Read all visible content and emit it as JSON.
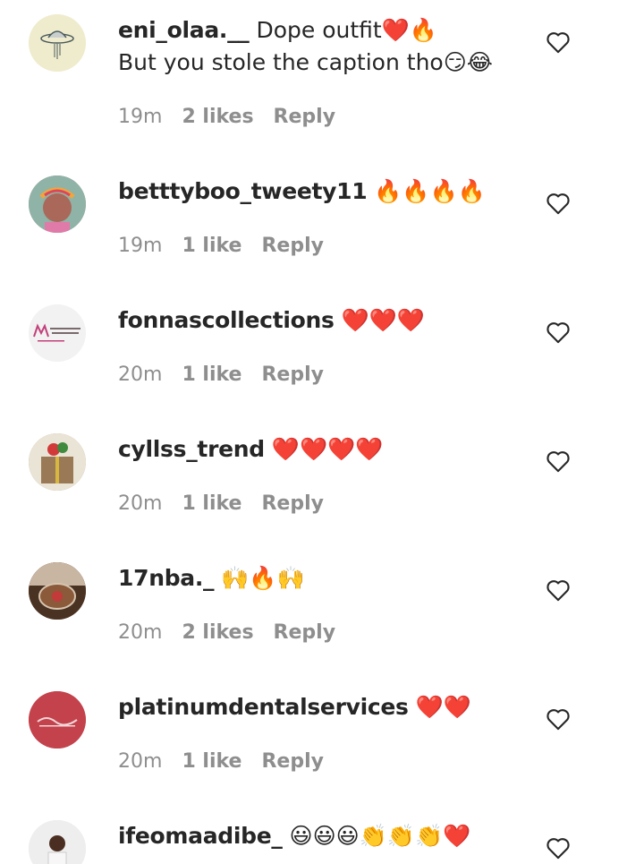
{
  "comments": [
    {
      "username": "eni_olaa.__",
      "text": "Dope outfit❤️🔥",
      "text2": "But you stole the caption tho😏😂",
      "time": "19m",
      "likes": "2 likes",
      "reply": "Reply",
      "avatar_icon": "ufo-icon",
      "avatar_color": "#efeccd"
    },
    {
      "username": "betttyboo_tweety11",
      "text": "🔥🔥🔥🔥",
      "time": "19m",
      "likes": "1 like",
      "reply": "Reply",
      "avatar_icon": "child-photo",
      "avatar_color": "#c48a8a"
    },
    {
      "username": "fonnascollections",
      "text": "❤️❤️❤️",
      "time": "20m",
      "likes": "1 like",
      "reply": "Reply",
      "avatar_icon": "fonnas-logo",
      "avatar_color": "#f2f2f2"
    },
    {
      "username": "cyllss_trend",
      "text": "❤️❤️❤️❤️",
      "time": "20m",
      "likes": "1 like",
      "reply": "Reply",
      "avatar_icon": "gift-box-photo",
      "avatar_color": "#b39a78"
    },
    {
      "username": "17nba._",
      "text": "🙌🔥🙌",
      "time": "20m",
      "likes": "2 likes",
      "reply": "Reply",
      "avatar_icon": "tea-cup-photo",
      "avatar_color": "#6b4a33"
    },
    {
      "username": "platinumdentalservices",
      "text": "❤️❤️",
      "time": "20m",
      "likes": "1 like",
      "reply": "Reply",
      "avatar_icon": "platinum-logo",
      "avatar_color": "#c3424c"
    },
    {
      "username": "ifeomaadibe_",
      "text": "😃😃😃👏👏👏❤️",
      "time": "",
      "likes": "",
      "reply": "",
      "avatar_icon": "woman-photo",
      "avatar_color": "#e6e6e6"
    }
  ]
}
